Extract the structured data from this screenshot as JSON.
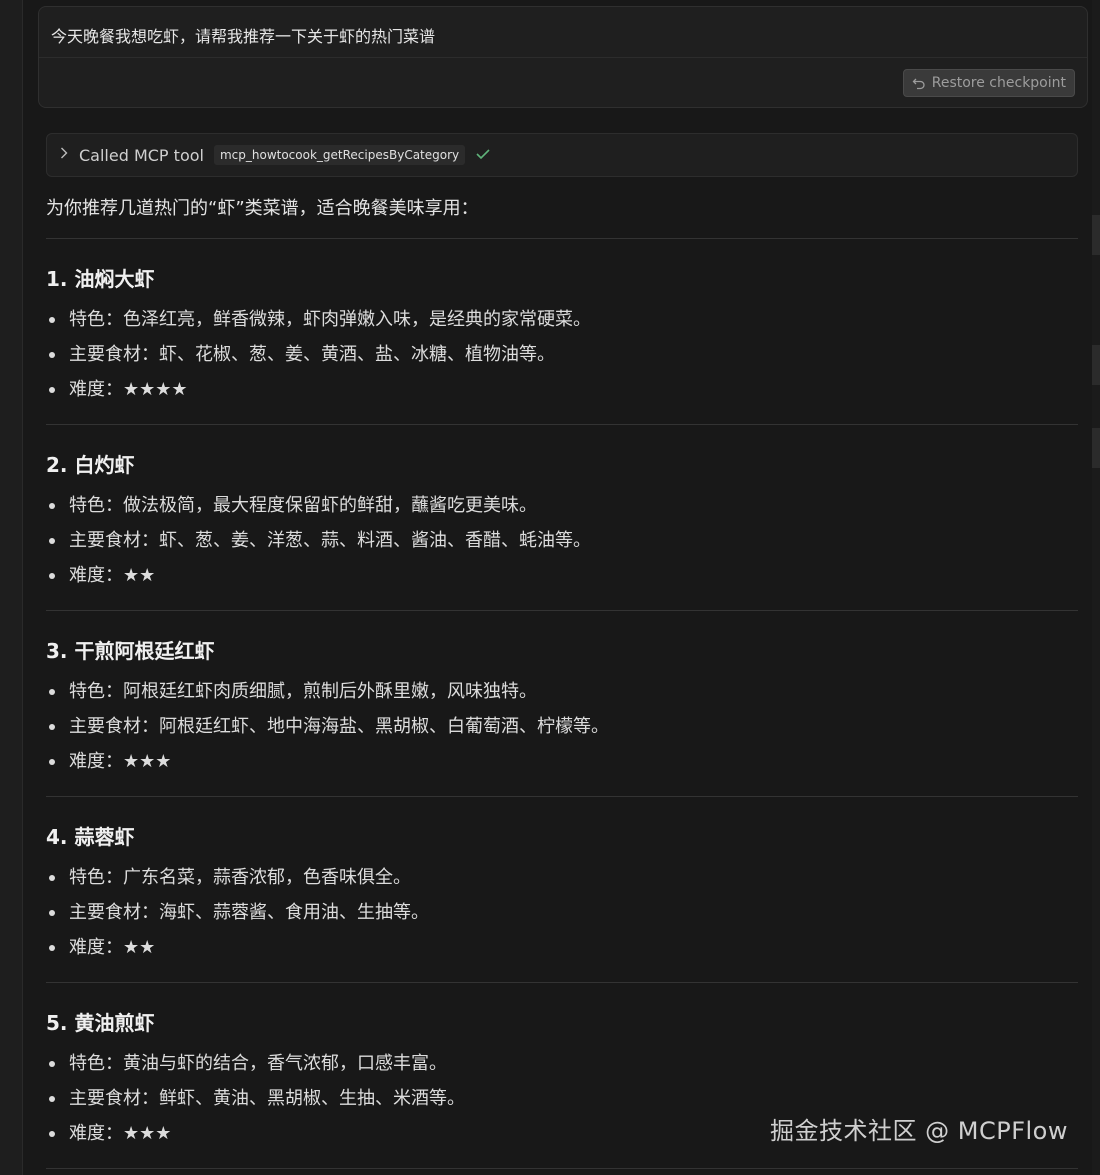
{
  "user_message": {
    "text": "今天晚餐我想吃虾，请帮我推荐一下关于虾的热门菜谱",
    "restore_label": "Restore checkpoint"
  },
  "tool_call": {
    "label": "Called MCP tool",
    "tool_name": "mcp_howtocook_getRecipesByCategory",
    "status": "success"
  },
  "response": {
    "intro": "为你推荐几道热门的“虾”类菜谱，适合晚餐美味享用：",
    "recipes": [
      {
        "title": "1. 油焖大虾",
        "feature": "特色：色泽红亮，鲜香微辣，虾肉弹嫩入味，是经典的家常硬菜。",
        "ingredients": "主要食材：虾、花椒、葱、姜、黄酒、盐、冰糖、植物油等。",
        "difficulty": "难度：★★★★"
      },
      {
        "title": "2. 白灼虾",
        "feature": "特色：做法极简，最大程度保留虾的鲜甜，蘸酱吃更美味。",
        "ingredients": "主要食材：虾、葱、姜、洋葱、蒜、料酒、酱油、香醋、蚝油等。",
        "difficulty": "难度：★★"
      },
      {
        "title": "3. 干煎阿根廷红虾",
        "feature": "特色：阿根廷红虾肉质细腻，煎制后外酥里嫩，风味独特。",
        "ingredients": "主要食材：阿根廷红虾、地中海海盐、黑胡椒、白葡萄酒、柠檬等。",
        "difficulty": "难度：★★★"
      },
      {
        "title": "4. 蒜蓉虾",
        "feature": "特色：广东名菜，蒜香浓郁，色香味俱全。",
        "ingredients": "主要食材：海虾、蒜蓉酱、食用油、生抽等。",
        "difficulty": "难度：★★"
      },
      {
        "title": "5. 黄油煎虾",
        "feature": "特色：黄油与虾的结合，香气浓郁，口感丰富。",
        "ingredients": "主要食材：鲜虾、黄油、黑胡椒、生抽、米酒等。",
        "difficulty": "难度：★★★"
      }
    ]
  },
  "watermark": "掘金技术社区 @ MCPFlow",
  "colors": {
    "background": "#181818",
    "panel": "#1f1f1f",
    "success": "#5fb37a"
  }
}
